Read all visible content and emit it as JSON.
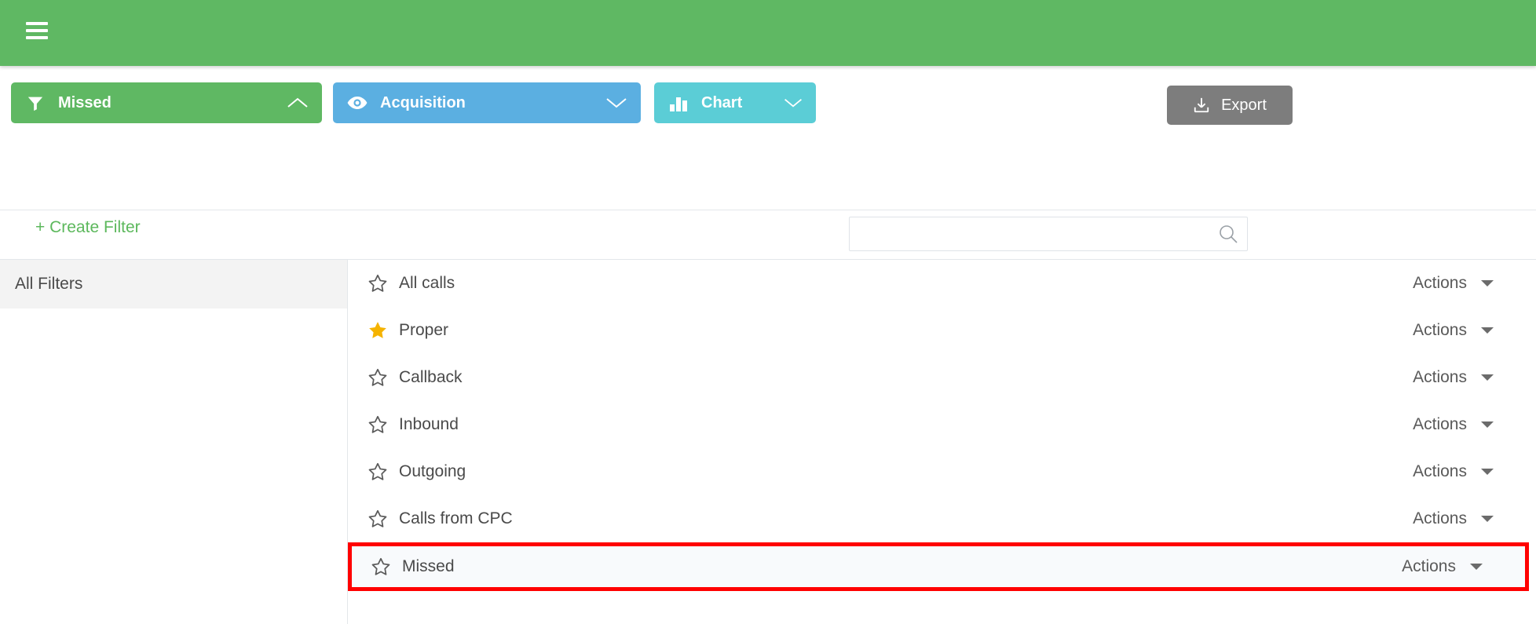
{
  "appbar": {
    "menu_icon": "hamburger-menu-icon"
  },
  "toolbar": {
    "buttons": [
      {
        "id": "missed",
        "label": "Missed",
        "icon": "filter-funnel-icon",
        "chevron": "chevron-up-icon",
        "color": "#5fb863"
      },
      {
        "id": "acquisition",
        "label": "Acquisition",
        "icon": "eye-icon",
        "chevron": "chevron-down-icon",
        "color": "#5bafe1"
      },
      {
        "id": "chart",
        "label": "Chart",
        "icon": "bar-chart-icon",
        "chevron": "chevron-down-icon",
        "color": "#5bcdd6"
      }
    ],
    "export": {
      "label": "Export",
      "icon": "download-icon",
      "color": "#7d7d7d"
    }
  },
  "filters_bar": {
    "create_filter_label": "+ Create Filter",
    "create_filter_color": "#5cb85c",
    "search": {
      "value": "",
      "placeholder": "",
      "icon": "search-icon"
    }
  },
  "sidebar": {
    "items": [
      {
        "label": "All Filters",
        "active": true
      }
    ]
  },
  "list": {
    "actions_label": "Actions",
    "star_filled_color": "#f5b300",
    "highlight_color": "#ff0000",
    "rows": [
      {
        "label": "All calls",
        "starred": false,
        "highlighted": false
      },
      {
        "label": "Proper",
        "starred": true,
        "highlighted": false
      },
      {
        "label": "Callback",
        "starred": false,
        "highlighted": false
      },
      {
        "label": "Inbound",
        "starred": false,
        "highlighted": false
      },
      {
        "label": "Outgoing",
        "starred": false,
        "highlighted": false
      },
      {
        "label": "Calls from CPC",
        "starred": false,
        "highlighted": false
      },
      {
        "label": "Missed",
        "starred": false,
        "highlighted": true
      }
    ]
  }
}
